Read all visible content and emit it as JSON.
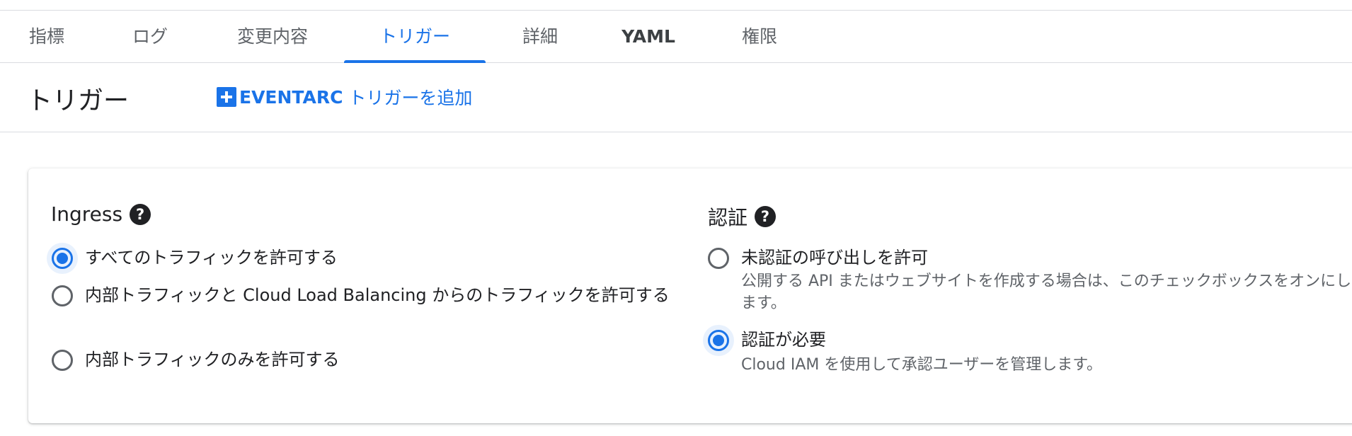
{
  "tabs": [
    {
      "label": "指標",
      "active": false
    },
    {
      "label": "ログ",
      "active": false
    },
    {
      "label": "変更内容",
      "active": false
    },
    {
      "label": "トリガー",
      "active": true
    },
    {
      "label": "詳細",
      "active": false
    },
    {
      "label": "YAML",
      "active": false
    },
    {
      "label": "権限",
      "active": false
    }
  ],
  "header": {
    "title": "トリガー",
    "add_button_bold": "EVENTARC",
    "add_button_rest": " トリガーを追加",
    "add_icon": "plus-box-icon"
  },
  "ingress": {
    "title": "Ingress",
    "help_icon": "help-circle-icon",
    "options": [
      {
        "label": "すべてのトラフィックを許可する",
        "checked": true
      },
      {
        "label": "内部トラフィックと Cloud Load Balancing からのトラフィックを許可する",
        "checked": false
      },
      {
        "label": "内部トラフィックのみを許可する",
        "checked": false
      }
    ]
  },
  "auth": {
    "title": "認証",
    "help_icon": "help-circle-icon",
    "options": [
      {
        "label": "未認証の呼び出しを許可",
        "description": "公開する API またはウェブサイトを作成する場合は、このチェックボックスをオンにします。",
        "checked": false
      },
      {
        "label": "認証が必要",
        "description": "Cloud IAM を使用して承認ユーザーを管理します。",
        "checked": true
      }
    ]
  },
  "colors": {
    "accent": "#1a73e8",
    "text": "#202124",
    "muted": "#5f6368",
    "divider": "#dadce0"
  }
}
